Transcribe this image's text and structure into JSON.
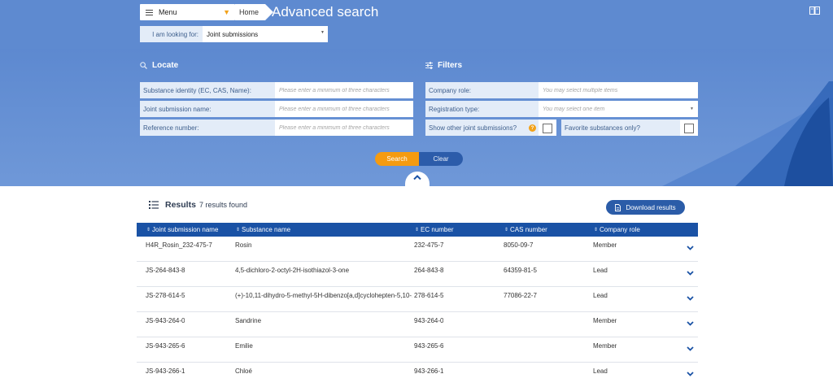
{
  "header": {
    "menu_label": "Menu",
    "breadcrumb_home": "Home",
    "page_title": "Advanced search"
  },
  "looking_for": {
    "label": "I am looking for:",
    "value": "Joint submissions"
  },
  "locate": {
    "heading": "Locate",
    "fields": [
      {
        "label": "Substance identity (EC, CAS, Name):",
        "placeholder": "Please enter a minimum of three characters"
      },
      {
        "label": "Joint submission name:",
        "placeholder": "Please enter a minimum of three characters"
      },
      {
        "label": "Reference number:",
        "placeholder": "Please enter a minimum of three characters"
      }
    ]
  },
  "filters": {
    "heading": "Filters",
    "company_role": {
      "label": "Company role:",
      "placeholder": "You may select multiple items"
    },
    "registration_type": {
      "label": "Registration type:",
      "placeholder": "You may select one item"
    },
    "show_other": {
      "label": "Show other joint submissions?",
      "info": "?"
    },
    "favorites": {
      "label": "Favorite substances only?"
    }
  },
  "actions": {
    "search_label": "Search",
    "clear_label": "Clear"
  },
  "results": {
    "title": "Results",
    "count_text": "7 results found",
    "download_label": "Download results",
    "columns": [
      "Joint submission name",
      "Substance name",
      "EC number",
      "CAS number",
      "Company role"
    ],
    "rows": [
      {
        "js_name": "H4R_Rosin_232-475-7",
        "substance": "Rosin",
        "ec": "232-475-7",
        "cas": "8050-09-7",
        "role": "Member"
      },
      {
        "js_name": "JS-264-843-8",
        "substance": "4,5-dichloro-2-octyl-2H-isothiazol-3-one",
        "ec": "264-843-8",
        "cas": "64359-81-5",
        "role": "Lead"
      },
      {
        "js_name": "JS-278-614-5",
        "substance": "(+)-10,11-dihydro-5-methyl-5H-dibenzo[a,d]cyclohepten-5,10-...",
        "ec": "278-614-5",
        "cas": "77086-22-7",
        "role": "Lead"
      },
      {
        "js_name": "JS-943-264-0",
        "substance": "Sandrine",
        "ec": "943-264-0",
        "cas": "",
        "role": "Member"
      },
      {
        "js_name": "JS-943-265-6",
        "substance": "Emilie",
        "ec": "943-265-6",
        "cas": "",
        "role": "Member"
      },
      {
        "js_name": "JS-943-266-1",
        "substance": "Chloé",
        "ec": "943-266-1",
        "cas": "",
        "role": "Lead"
      }
    ]
  },
  "colors": {
    "header_blue": "#5e8ad0",
    "table_header": "#1a52a5",
    "accent_orange": "#f59b10",
    "button_blue": "#2b5ca8"
  },
  "icons": [
    "hamburger-icon",
    "chevron-down-icon",
    "book-icon",
    "search-icon",
    "filter-icon",
    "info-icon",
    "chevron-up-icon",
    "list-icon",
    "document-icon",
    "sort-icon"
  ]
}
